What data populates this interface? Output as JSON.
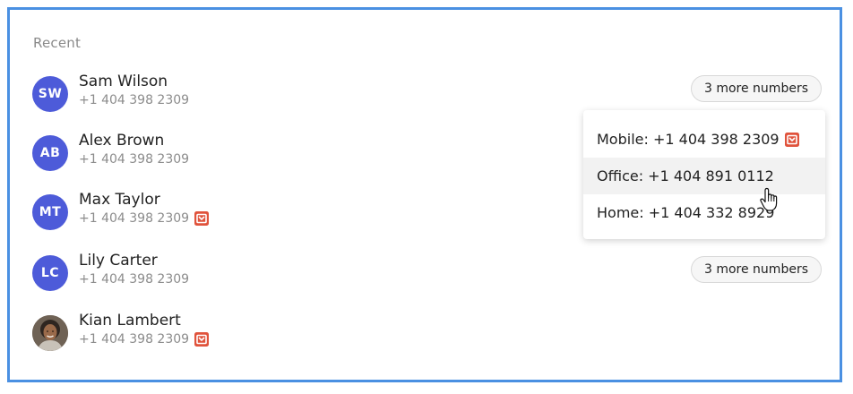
{
  "section_title": "Recent",
  "contacts": [
    {
      "initials": "SW",
      "name": "Sam Wilson",
      "phone": "+1 404 398 2309",
      "has_m_badge": false,
      "more_label": "3 more numbers"
    },
    {
      "initials": "AB",
      "name": "Alex Brown",
      "phone": "+1 404 398 2309",
      "has_m_badge": false
    },
    {
      "initials": "MT",
      "name": "Max Taylor",
      "phone": "+1 404 398 2309",
      "has_m_badge": true
    },
    {
      "initials": "LC",
      "name": "Lily Carter",
      "phone": "+1 404 398 2309",
      "has_m_badge": false,
      "more_label": "3 more numbers"
    },
    {
      "initials": "",
      "name": "Kian Lambert",
      "phone": "+1 404 398 2309",
      "has_m_badge": true,
      "avatar_type": "photo"
    }
  ],
  "dropdown": {
    "items": [
      {
        "label": "Mobile: +1 404 398 2309",
        "has_m_badge": true
      },
      {
        "label": "Office: +1 404 891 0112",
        "hovered": true
      },
      {
        "label": "Home: +1 404 332 8929"
      }
    ]
  },
  "colors": {
    "frame_border": "#4a90e2",
    "avatar_bg": "#4d5bd9",
    "badge_red": "#e0533c",
    "hover_bg": "#f2f2f2"
  },
  "icons": {
    "badge": "m-badge-icon",
    "cursor": "hand-pointer-icon"
  }
}
